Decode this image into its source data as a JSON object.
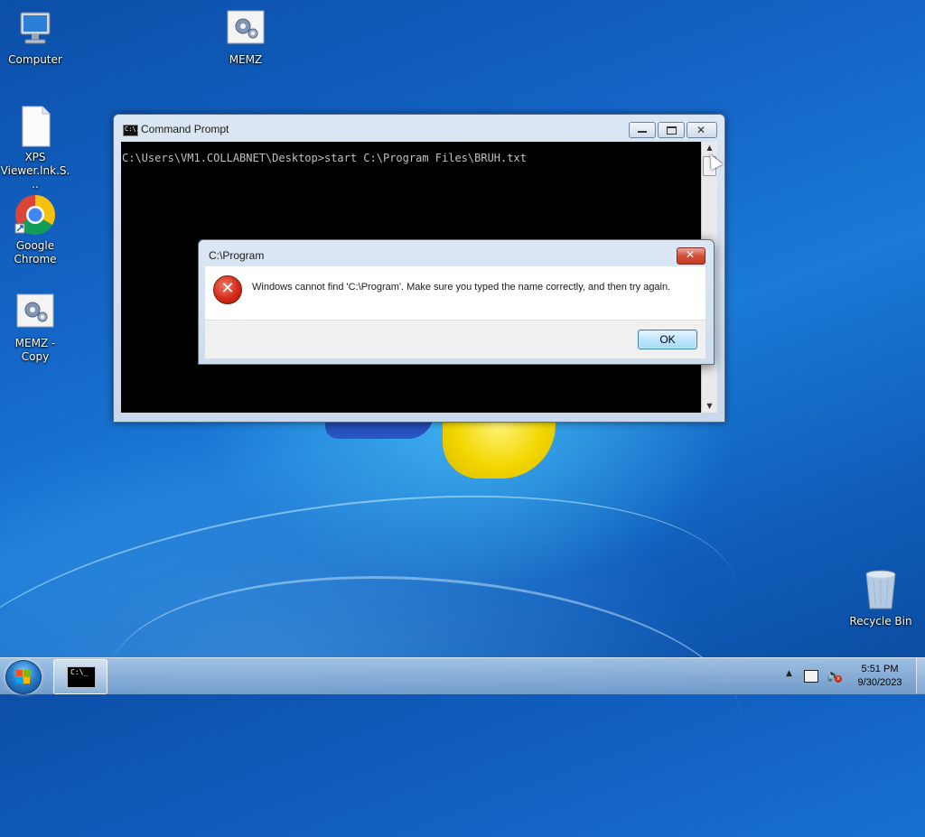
{
  "desktop": {
    "icons": [
      {
        "label": "Computer",
        "icon": "computer-icon"
      },
      {
        "label": "MEMZ",
        "icon": "gear-document-icon"
      },
      {
        "label": "XPS Viewer.lnk.S...",
        "icon": "blank-document-icon"
      },
      {
        "label": "Google Chrome",
        "icon": "chrome-icon"
      },
      {
        "label": "MEMZ - Copy",
        "icon": "gear-document-icon"
      },
      {
        "label": "Recycle Bin",
        "icon": "recycle-bin-icon"
      }
    ]
  },
  "cmd": {
    "title": "Command Prompt",
    "app_icon_text": "C:\\.",
    "line": "C:\\Users\\VM1.COLLABNET\\Desktop>start C:\\Program Files\\BRUH.txt",
    "close_glyph": "✕",
    "scroll_up": "▲",
    "scroll_down": "▼"
  },
  "dialog": {
    "title": "C:\\Program",
    "close_glyph": "✕",
    "error_glyph": "✕",
    "message": "Windows cannot find 'C:\\Program'. Make sure you typed the name correctly, and then try again.",
    "ok_label": "OK"
  },
  "taskbar": {
    "task_icon_text": "C:\\_",
    "tray_arrow": "▲",
    "volume_glyph": "🔈",
    "mute_glyph": "x",
    "time": "5:51 PM",
    "date": "9/30/2023"
  },
  "colors": {
    "accent_blue": "#1466c8",
    "error_red": "#d42a1a",
    "console_bg": "#000000",
    "console_text": "#c0c0c0"
  }
}
